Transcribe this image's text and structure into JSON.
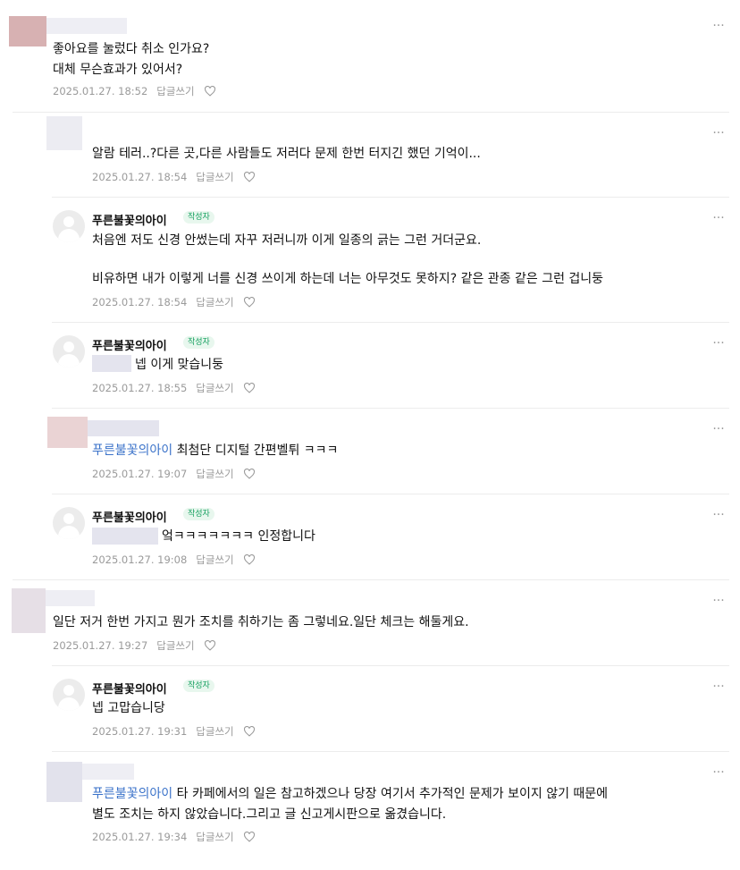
{
  "comments": [
    {
      "text1": "좋아요를 눌렀다 취소 인가요?",
      "text2": "대체 무슨효과가 있어서?",
      "date": "2025.01.27. 18:52",
      "reply": "답글쓰기"
    },
    {
      "text1": "알람 테러..?다른 곳,다른 사람들도 저러다 문제 한번 터지긴 했던 기억이...",
      "date": "2025.01.27. 18:54",
      "reply": "답글쓰기"
    },
    {
      "nickname": "푸른불꽃의아이",
      "badge": "작성자",
      "text1": "처음엔 저도 신경 안썼는데 자꾸 저러니까 이게 일종의 긁는 그런 거더군요.",
      "text2": "비유하면 내가 이렇게 너를 신경 쓰이게 하는데 너는 아무것도 못하지? 같은 관종 같은 그런 겁니둥",
      "date": "2025.01.27. 18:54",
      "reply": "답글쓰기"
    },
    {
      "nickname": "푸른불꽃의아이",
      "badge": "작성자",
      "text1": "넵 이게 맞습니둥",
      "date": "2025.01.27. 18:55",
      "reply": "답글쓰기"
    },
    {
      "mention": "푸른불꽃의아이",
      "text1": "최첨단 디지털 간편벨튀 ㅋㅋㅋ",
      "date": "2025.01.27. 19:07",
      "reply": "답글쓰기"
    },
    {
      "nickname": "푸른불꽃의아이",
      "badge": "작성자",
      "text1": "엌ㅋㅋㅋㅋㅋㅋㅋ 인정합니다",
      "date": "2025.01.27. 19:08",
      "reply": "답글쓰기"
    },
    {
      "text1": "일단 저거 한번 가지고 뭔가 조치를 취하기는 좀 그렇네요.일단 체크는 해둘게요.",
      "date": "2025.01.27. 19:27",
      "reply": "답글쓰기"
    },
    {
      "nickname": "푸른불꽃의아이",
      "badge": "작성자",
      "text1": "넵 고맙습니당",
      "date": "2025.01.27. 19:31",
      "reply": "답글쓰기"
    },
    {
      "mention": "푸른불꽃의아이",
      "text1": "타 카페에서의 일은 참고하겠으나 당장 여기서 추가적인 문제가 보이지 않기 때문에",
      "text2": "별도 조치는 하지 않았습니다.그리고 글 신고게시판으로 옮겼습니다.",
      "date": "2025.01.27. 19:34",
      "reply": "답글쓰기"
    }
  ],
  "icons": {
    "more": "more-dots-icon",
    "like": "heart-outline-icon",
    "avatar": "default-avatar-icon"
  },
  "colors": {
    "mention": "#3a72c9",
    "badge_text": "#16a060",
    "badge_bg": "#e8f7ee",
    "meta": "#9a9a9a"
  }
}
